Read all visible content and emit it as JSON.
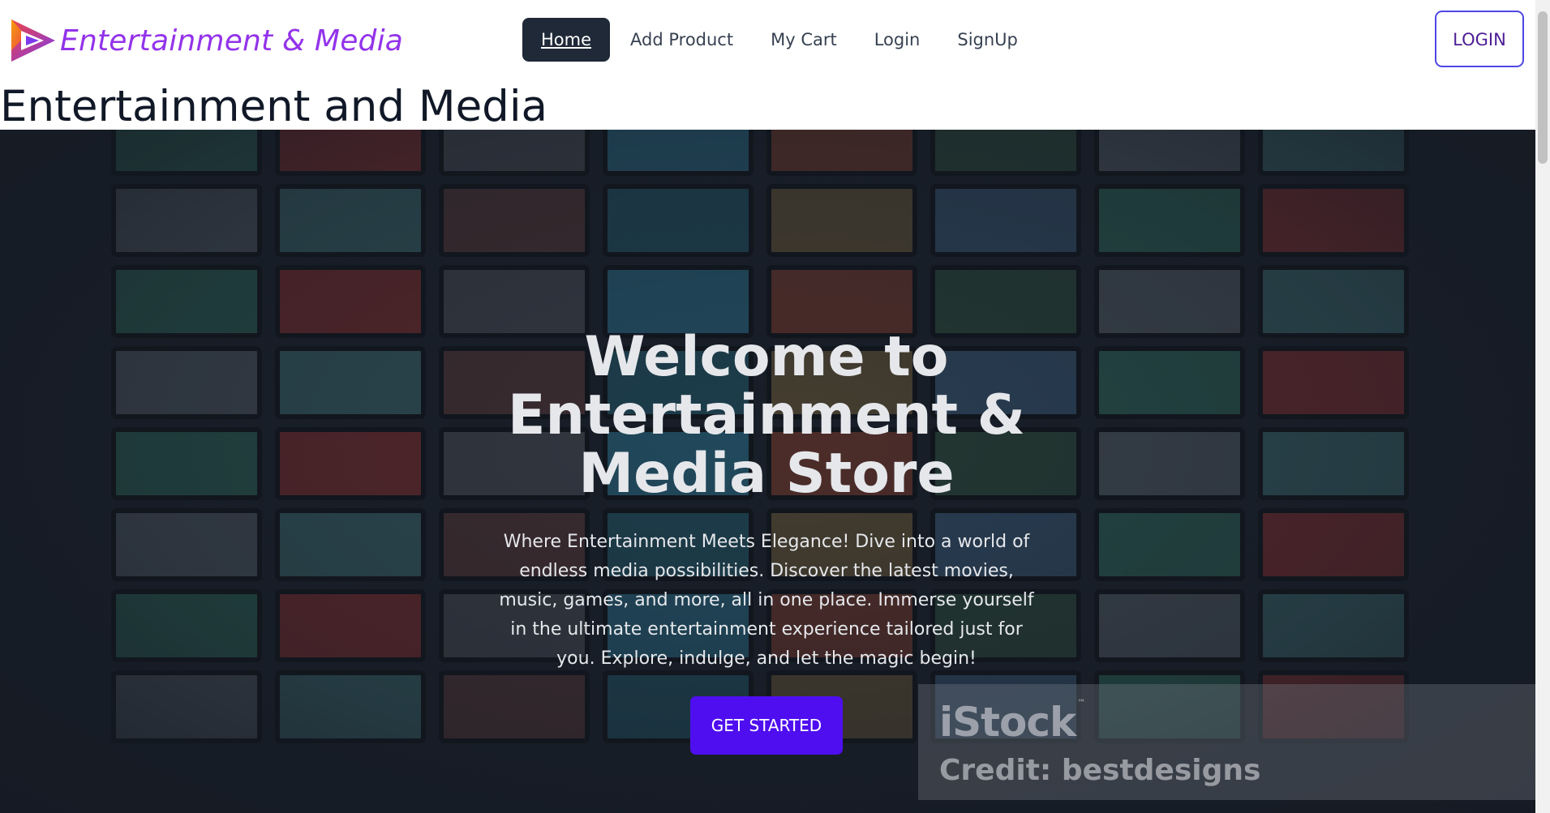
{
  "brand": {
    "name": "Entertainment & Media",
    "logo_icon": "play-logo-icon",
    "color": "#9333ea"
  },
  "nav": {
    "items": [
      {
        "label": "Home",
        "active": true
      },
      {
        "label": "Add Product",
        "active": false
      },
      {
        "label": "My Cart",
        "active": false
      },
      {
        "label": "Login",
        "active": false
      },
      {
        "label": "SignUp",
        "active": false
      }
    ],
    "login_button": "LOGIN"
  },
  "page": {
    "heading": "Entertainment and Media"
  },
  "hero": {
    "title_line1": "Welcome to",
    "title_line2": "Entertainment &",
    "title_line3": "Media Store",
    "description": "Where Entertainment Meets Elegance! Dive into a world of endless media possibilities. Discover the latest movies, music, games, and more, all in one place. Immerse yourself in the ultimate entertainment experience tailored just for you. Explore, indulge, and let the magic begin!",
    "cta": "GET STARTED",
    "cta_color": "#4f0ef0"
  },
  "watermark": {
    "brand": "iStock",
    "tm": "™",
    "credit": "Credit: bestdesigns"
  },
  "colors": {
    "active_nav_bg": "#1f2937",
    "login_border": "#4f46e5",
    "hero_bg": "#1b222c"
  }
}
